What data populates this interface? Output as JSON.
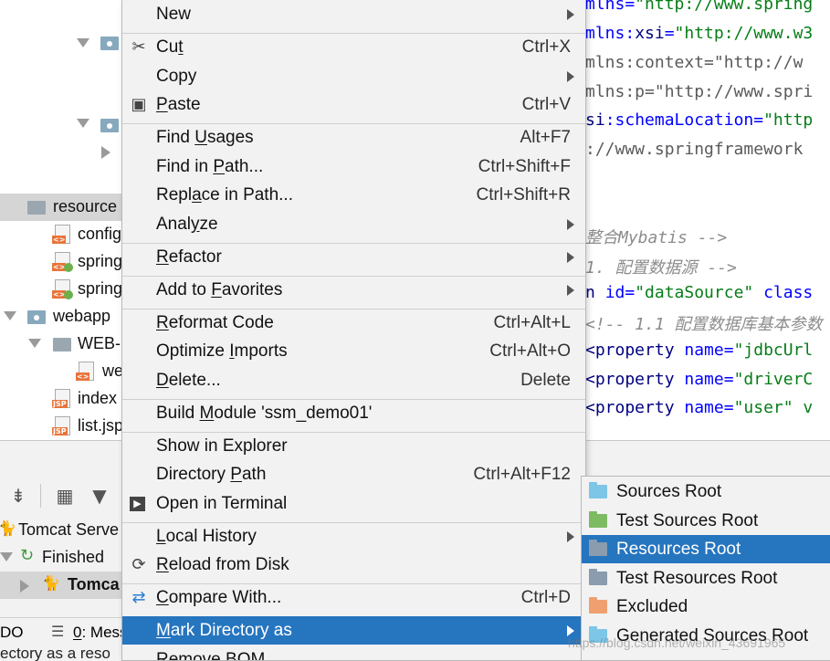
{
  "project_tree": {
    "rows": [
      {
        "label": "resource"
      },
      {
        "label": "config"
      },
      {
        "label": "spring"
      },
      {
        "label": "spring"
      },
      {
        "label": "webapp"
      },
      {
        "label": "WEB-"
      },
      {
        "label": "we"
      },
      {
        "label": "index"
      },
      {
        "label": "list.jsp"
      }
    ],
    "file_tag": "JSP"
  },
  "editor": {
    "lines": [
      {
        "parts": [
          {
            "t": "mlns=",
            "c": "at"
          },
          {
            "t": "\"http://www.spring",
            "c": "st"
          }
        ]
      },
      {
        "parts": [
          {
            "t": "mlns:",
            "c": "at"
          },
          {
            "t": "xsi",
            "c": "kw"
          },
          {
            "t": "=",
            "c": "at"
          },
          {
            "t": "\"http://www.w3",
            "c": "st"
          }
        ]
      },
      {
        "parts": [
          {
            "t": "mlns:context=\"http://w",
            "c": "cm2"
          }
        ]
      },
      {
        "parts": [
          {
            "t": "mlns:p=\"http://www.spri",
            "c": "cm2"
          }
        ]
      },
      {
        "parts": [
          {
            "t": "si",
            "c": "kw"
          },
          {
            "t": ":schemaLocation=",
            "c": "at"
          },
          {
            "t": "\"http",
            "c": "st"
          }
        ]
      },
      {
        "parts": [
          {
            "t": "://www.springframework",
            "c": "cm2"
          }
        ]
      },
      {
        "parts": []
      },
      {
        "parts": [
          {
            "t": " 整合Mybatis -->",
            "c": "cm"
          }
        ]
      },
      {
        "parts": [
          {
            "t": " 1. 配置数据源 -->",
            "c": "cm"
          }
        ]
      },
      {
        "parts": [
          {
            "t": "n ",
            "c": "kw"
          },
          {
            "t": "id=",
            "c": "at"
          },
          {
            "t": "\"dataSource\"",
            "c": "st"
          },
          {
            "t": " class",
            "c": "at"
          }
        ]
      },
      {
        "parts": [
          {
            "t": "<!-- 1.1 配置数据库基本参数",
            "c": "cm"
          }
        ]
      },
      {
        "parts": [
          {
            "t": "<property ",
            "c": "kw"
          },
          {
            "t": "name=",
            "c": "at"
          },
          {
            "t": "\"jdbcUrl",
            "c": "st"
          }
        ]
      },
      {
        "parts": [
          {
            "t": "<property ",
            "c": "kw"
          },
          {
            "t": "name=",
            "c": "at"
          },
          {
            "t": "\"driverC",
            "c": "st"
          }
        ]
      },
      {
        "parts": [
          {
            "t": "<property ",
            "c": "kw"
          },
          {
            "t": "name=",
            "c": "at"
          },
          {
            "t": "\"user\" v",
            "c": "st"
          }
        ]
      }
    ]
  },
  "context_menu": {
    "items": [
      {
        "label": "New",
        "u": "",
        "shortcut": "",
        "submenu": true,
        "icon": ""
      },
      {
        "label": "Cut",
        "shortcut": "Ctrl+X",
        "submenu": false,
        "icon": "scissors-icon"
      },
      {
        "label": "Copy",
        "shortcut": "",
        "submenu": true,
        "icon": ""
      },
      {
        "label": "Paste",
        "shortcut": "Ctrl+V",
        "submenu": false,
        "icon": "clipboard-icon"
      },
      {
        "label": "Find Usages",
        "shortcut": "Alt+F7",
        "submenu": false,
        "icon": ""
      },
      {
        "label": "Find in Path...",
        "shortcut": "Ctrl+Shift+F",
        "submenu": false,
        "icon": ""
      },
      {
        "label": "Replace in Path...",
        "shortcut": "Ctrl+Shift+R",
        "submenu": false,
        "icon": ""
      },
      {
        "label": "Analyze",
        "shortcut": "",
        "submenu": true,
        "icon": ""
      },
      {
        "label": "Refactor",
        "shortcut": "",
        "submenu": true,
        "icon": ""
      },
      {
        "label": "Add to Favorites",
        "shortcut": "",
        "submenu": true,
        "icon": ""
      },
      {
        "label": "Reformat Code",
        "shortcut": "Ctrl+Alt+L",
        "submenu": false,
        "icon": ""
      },
      {
        "label": "Optimize Imports",
        "shortcut": "Ctrl+Alt+O",
        "submenu": false,
        "icon": ""
      },
      {
        "label": "Delete...",
        "shortcut": "Delete",
        "submenu": false,
        "icon": ""
      },
      {
        "label": "Build Module 'ssm_demo01'",
        "shortcut": "",
        "submenu": false,
        "icon": ""
      },
      {
        "label": "Show in Explorer",
        "shortcut": "",
        "submenu": false,
        "icon": ""
      },
      {
        "label": "Directory Path",
        "shortcut": "Ctrl+Alt+F12",
        "submenu": false,
        "icon": ""
      },
      {
        "label": "Open in Terminal",
        "shortcut": "",
        "submenu": false,
        "icon": "terminal-icon"
      },
      {
        "label": "Local History",
        "shortcut": "",
        "submenu": true,
        "icon": ""
      },
      {
        "label": "Reload from Disk",
        "shortcut": "",
        "submenu": false,
        "icon": "reload-icon"
      },
      {
        "label": "Compare With...",
        "shortcut": "Ctrl+D",
        "submenu": false,
        "icon": "compare-icon"
      },
      {
        "label": "Mark Directory as",
        "shortcut": "",
        "submenu": true,
        "icon": "",
        "active": true
      },
      {
        "label": "Remove BOM",
        "shortcut": "",
        "submenu": false,
        "icon": ""
      }
    ]
  },
  "submenu": {
    "items": [
      {
        "label": "Sources Root",
        "color": "#7ec6e8"
      },
      {
        "label": "Test Sources Root",
        "color": "#7dbb62"
      },
      {
        "label": "Resources Root",
        "color": "#8a9cad",
        "active": true
      },
      {
        "label": "Test Resources Root",
        "color": "#8a9cad"
      },
      {
        "label": "Excluded",
        "color": "#f0a070"
      },
      {
        "label": "Generated Sources Root",
        "color": "#7ec6e8"
      }
    ]
  },
  "run_panel": {
    "rows": [
      {
        "label": "Tomcat Serve"
      },
      {
        "label": "Finished"
      },
      {
        "label": "Tomca"
      }
    ]
  },
  "status_bar": {
    "todo": "DO",
    "messages_num": "0",
    "messages": ": Mess"
  },
  "hint": "ectory as a reso",
  "watermark": "https://blog.csdn.net/weixin_43691965",
  "colors": {
    "menu_highlight": "#2675bf",
    "menu_bg": "#f2f2f2"
  }
}
